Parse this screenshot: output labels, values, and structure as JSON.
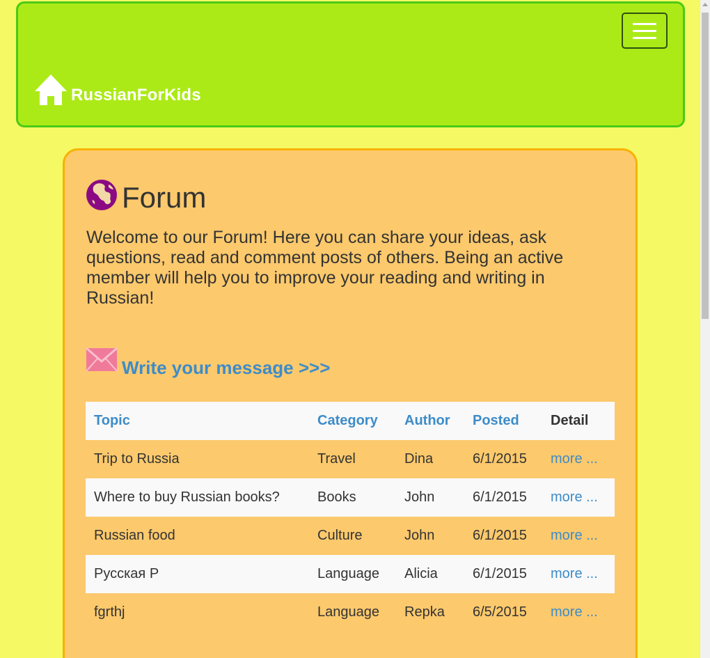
{
  "navbar": {
    "brand": "RussianForKids",
    "home_icon": "home-icon",
    "menu_icon": "hamburger-menu-icon"
  },
  "page": {
    "title": "Forum",
    "title_icon": "globe-icon",
    "intro": "Welcome to our Forum! Here you can share your ideas, ask questions, read and comment posts of others. Being an active member will help you to improve your reading and writing in Russian!",
    "write_link": "Write your message >>>",
    "write_icon": "envelope-icon"
  },
  "table": {
    "headers": {
      "topic": "Topic",
      "category": "Category",
      "author": "Author",
      "posted": "Posted",
      "detail": "Detail"
    },
    "rows": [
      {
        "topic": "Trip to Russia",
        "category": "Travel",
        "author": "Dina",
        "posted": "6/1/2015",
        "detail": "more ..."
      },
      {
        "topic": "Where to buy Russian books?",
        "category": "Books",
        "author": "John",
        "posted": "6/1/2015",
        "detail": "more ..."
      },
      {
        "topic": "Russian food",
        "category": "Culture",
        "author": "John",
        "posted": "6/1/2015",
        "detail": "more ..."
      },
      {
        "topic": "Русская Р",
        "category": "Language",
        "author": "Alicia",
        "posted": "6/1/2015",
        "detail": "more ..."
      },
      {
        "topic": "fgrthj",
        "category": "Language",
        "author": "Repka",
        "posted": "6/5/2015",
        "detail": "more ..."
      }
    ]
  },
  "colors": {
    "page_bg": "#f5f963",
    "navbar_bg": "#acea17",
    "navbar_border": "#4bc918",
    "panel_bg": "#fcc96c",
    "panel_border": "#f8b105",
    "link": "#3d8cc9",
    "globe": "#8b0a83",
    "envelope": "#f07a9a"
  }
}
